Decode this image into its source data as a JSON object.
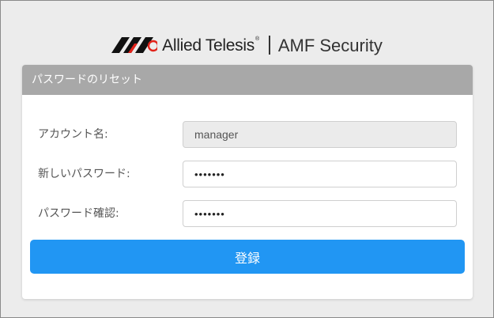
{
  "brand": {
    "company_name": "Allied Telesis",
    "trademark": "®",
    "product_title": "AMF Security",
    "logo_icon": "allied-telesis-logo-icon"
  },
  "card": {
    "title": "パスワードのリセット",
    "header_color": "#a8a8a8"
  },
  "form": {
    "account": {
      "label": "アカウント名:",
      "value": "manager"
    },
    "new_password": {
      "label": "新しいパスワード:",
      "value": "1234567"
    },
    "confirm_password": {
      "label": "パスワード確認:",
      "value": "1234567"
    },
    "submit_label": "登録",
    "submit_color": "#2196f3"
  }
}
